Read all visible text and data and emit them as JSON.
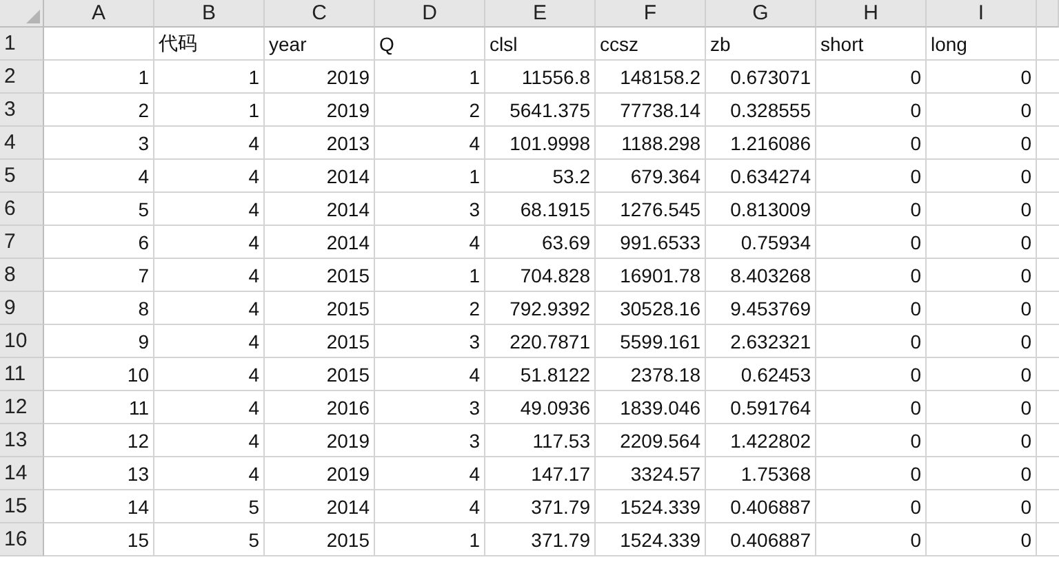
{
  "columns": [
    "A",
    "B",
    "C",
    "D",
    "E",
    "F",
    "G",
    "H",
    "I"
  ],
  "rows": [
    {
      "number": "1",
      "kind": "header",
      "cells": [
        null,
        "代码",
        "year",
        "Q",
        "clsl",
        "ccsz",
        "zb",
        "short",
        "long"
      ]
    },
    {
      "number": "2",
      "kind": "data",
      "cells": [
        "1",
        "1",
        "2019",
        "1",
        "11556.8",
        "148158.2",
        "0.673071",
        "0",
        "0"
      ]
    },
    {
      "number": "3",
      "kind": "data",
      "cells": [
        "2",
        "1",
        "2019",
        "2",
        "5641.375",
        "77738.14",
        "0.328555",
        "0",
        "0"
      ]
    },
    {
      "number": "4",
      "kind": "data",
      "cells": [
        "3",
        "4",
        "2013",
        "4",
        "101.9998",
        "1188.298",
        "1.216086",
        "0",
        "0"
      ]
    },
    {
      "number": "5",
      "kind": "data",
      "cells": [
        "4",
        "4",
        "2014",
        "1",
        "53.2",
        "679.364",
        "0.634274",
        "0",
        "0"
      ]
    },
    {
      "number": "6",
      "kind": "data",
      "cells": [
        "5",
        "4",
        "2014",
        "3",
        "68.1915",
        "1276.545",
        "0.813009",
        "0",
        "0"
      ]
    },
    {
      "number": "7",
      "kind": "data",
      "cells": [
        "6",
        "4",
        "2014",
        "4",
        "63.69",
        "991.6533",
        "0.75934",
        "0",
        "0"
      ]
    },
    {
      "number": "8",
      "kind": "data",
      "cells": [
        "7",
        "4",
        "2015",
        "1",
        "704.828",
        "16901.78",
        "8.403268",
        "0",
        "0"
      ]
    },
    {
      "number": "9",
      "kind": "data",
      "cells": [
        "8",
        "4",
        "2015",
        "2",
        "792.9392",
        "30528.16",
        "9.453769",
        "0",
        "0"
      ]
    },
    {
      "number": "10",
      "kind": "data",
      "cells": [
        "9",
        "4",
        "2015",
        "3",
        "220.7871",
        "5599.161",
        "2.632321",
        "0",
        "0"
      ]
    },
    {
      "number": "11",
      "kind": "data",
      "cells": [
        "10",
        "4",
        "2015",
        "4",
        "51.8122",
        "2378.18",
        "0.62453",
        "0",
        "0"
      ]
    },
    {
      "number": "12",
      "kind": "data",
      "cells": [
        "11",
        "4",
        "2016",
        "3",
        "49.0936",
        "1839.046",
        "0.591764",
        "0",
        "0"
      ]
    },
    {
      "number": "13",
      "kind": "data",
      "cells": [
        "12",
        "4",
        "2019",
        "3",
        "117.53",
        "2209.564",
        "1.422802",
        "0",
        "0"
      ]
    },
    {
      "number": "14",
      "kind": "data",
      "cells": [
        "13",
        "4",
        "2019",
        "4",
        "147.17",
        "3324.57",
        "1.75368",
        "0",
        "0"
      ]
    },
    {
      "number": "15",
      "kind": "data",
      "cells": [
        "14",
        "5",
        "2014",
        "4",
        "371.79",
        "1524.339",
        "0.406887",
        "0",
        "0"
      ]
    },
    {
      "number": "16",
      "kind": "data",
      "cells": [
        "15",
        "5",
        "2015",
        "1",
        "371.79",
        "1524.339",
        "0.406887",
        "0",
        "0"
      ]
    }
  ]
}
